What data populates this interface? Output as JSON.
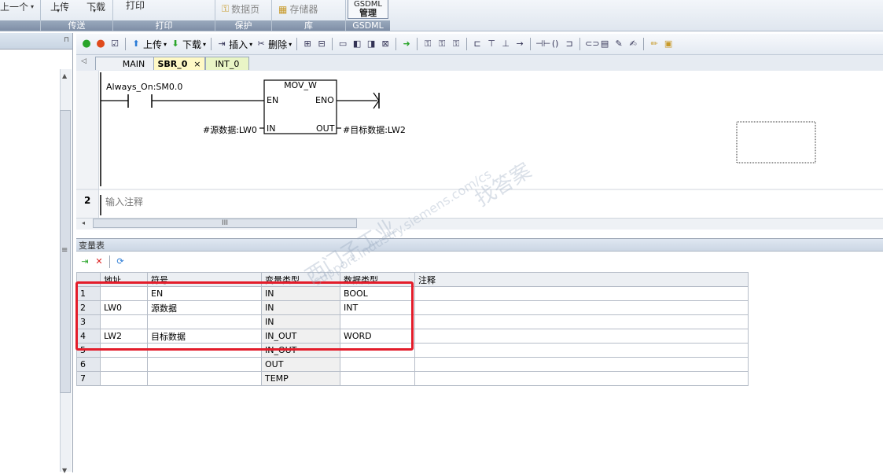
{
  "ribbon": {
    "prev_label": "上一个",
    "upload_label": "上传",
    "download_label": "下载",
    "print_label": "打印",
    "datapage_label": "数据页",
    "memory_label": "存储器",
    "gsdml_btn_line1": "GSDML",
    "gsdml_btn_line2": "管理",
    "groups": [
      "传送",
      "打印",
      "保护",
      "库",
      "GSDML"
    ]
  },
  "toolbar": {
    "upload_label": "上传",
    "download_label": "下载",
    "insert_label": "插入",
    "delete_label": "删除"
  },
  "tabs": [
    {
      "label": "MAIN"
    },
    {
      "label": "SBR_0",
      "active": true,
      "close": "×"
    },
    {
      "label": "INT_0"
    }
  ],
  "ladder": {
    "contact_label": "Always_On:SM0.0",
    "box_title": "MOV_W",
    "en": "EN",
    "eno": "ENO",
    "in": "IN",
    "out": "OUT",
    "in_operand": "#源数据:LW0",
    "out_operand": "#目标数据:LW2"
  },
  "network2": {
    "number": "2",
    "comment_placeholder": "输入注释"
  },
  "scroll_grip": "III",
  "var_table": {
    "title": "变量表",
    "columns": [
      "地址",
      "符号",
      "变量类型",
      "数据类型",
      "注释"
    ],
    "rows": [
      {
        "n": "1",
        "addr": "",
        "symbol": "EN",
        "vtype": "IN",
        "dtype": "BOOL",
        "comment": ""
      },
      {
        "n": "2",
        "addr": "LW0",
        "symbol": "源数据",
        "vtype": "IN",
        "dtype": "INT",
        "comment": ""
      },
      {
        "n": "3",
        "addr": "",
        "symbol": "",
        "vtype": "IN",
        "dtype": "",
        "comment": ""
      },
      {
        "n": "4",
        "addr": "LW2",
        "symbol": "目标数据",
        "vtype": "IN_OUT",
        "dtype": "WORD",
        "comment": ""
      },
      {
        "n": "5",
        "addr": "",
        "symbol": "",
        "vtype": "IN_OUT",
        "dtype": "",
        "comment": ""
      },
      {
        "n": "6",
        "addr": "",
        "symbol": "",
        "vtype": "OUT",
        "dtype": "",
        "comment": ""
      },
      {
        "n": "7",
        "addr": "",
        "symbol": "",
        "vtype": "TEMP",
        "dtype": "",
        "comment": ""
      }
    ]
  },
  "watermark": {
    "line1": "西门子工业",
    "line2": "support.industry.siemens.com/cs",
    "line3": "找答案"
  },
  "colors": {
    "highlight": "#e31c2a",
    "run_green": "#2aa52a",
    "stop_red": "#e04b1c"
  }
}
